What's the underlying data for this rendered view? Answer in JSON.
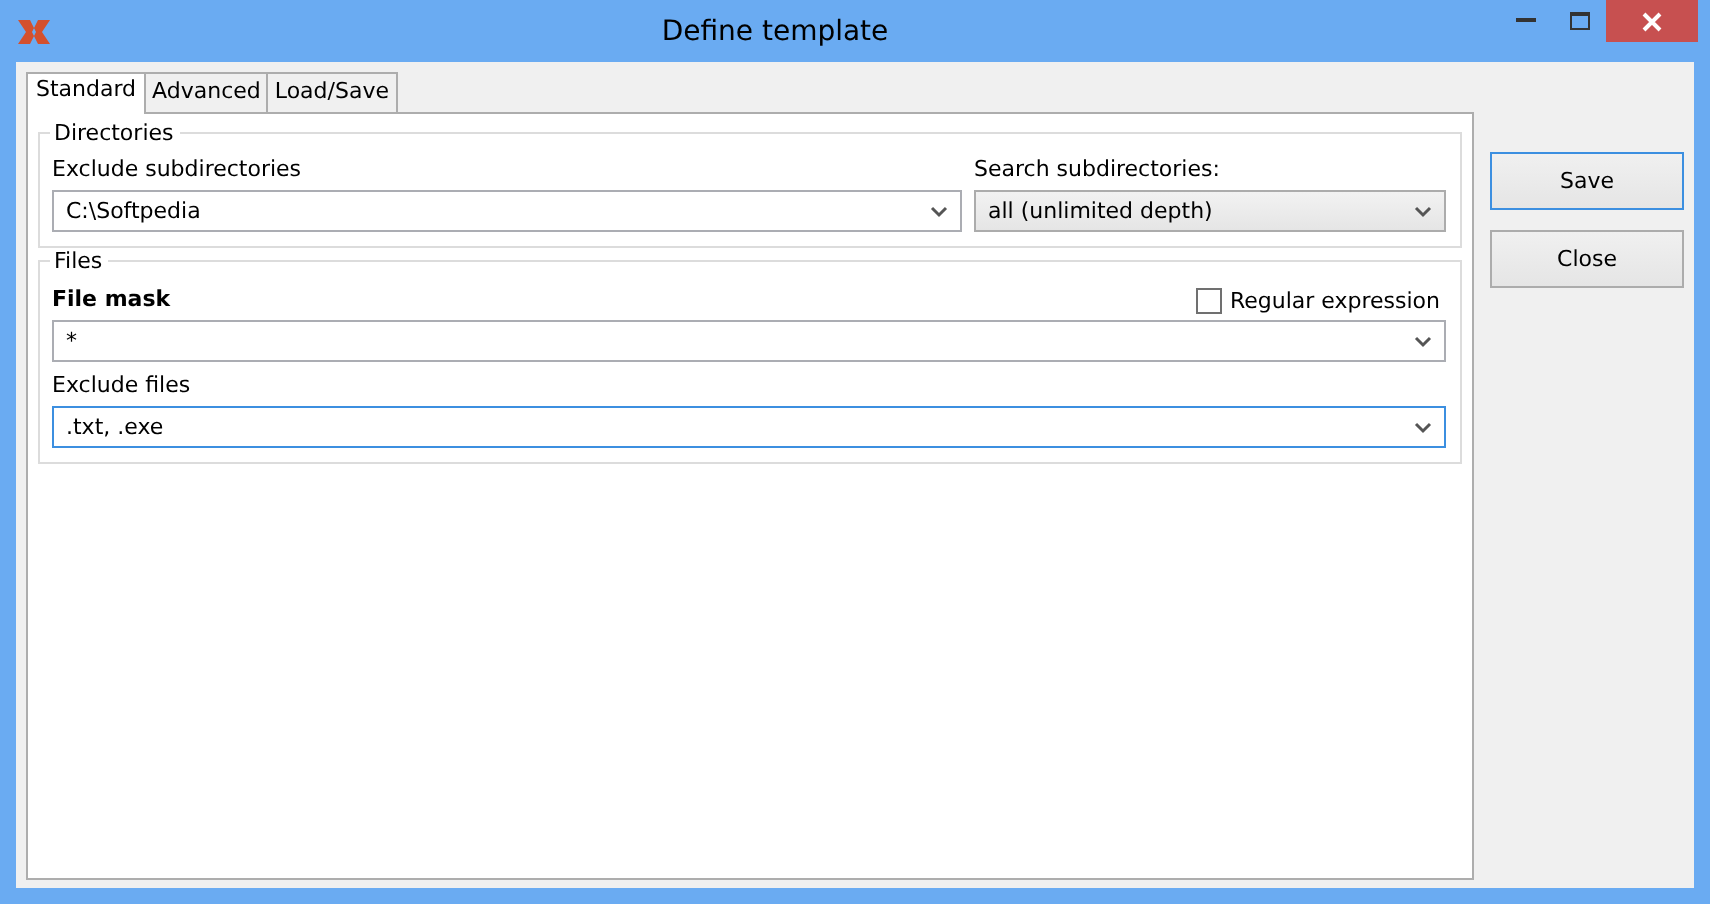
{
  "window": {
    "title": "Define template"
  },
  "tabs": [
    {
      "label": "Standard",
      "selected": true
    },
    {
      "label": "Advanced",
      "selected": false
    },
    {
      "label": "Load/Save",
      "selected": false
    }
  ],
  "directories": {
    "title": "Directories",
    "exclude_label": "Exclude subdirectories",
    "exclude_value": "C:\\Softpedia",
    "search_label": "Search subdirectories:",
    "search_value": "all (unlimited depth)"
  },
  "files": {
    "title": "Files",
    "mask_label": "File mask",
    "mask_value": "*",
    "regex_label": "Regular expression",
    "regex_checked": false,
    "exclude_label": "Exclude files",
    "exclude_value": ".txt, .exe"
  },
  "buttons": [
    {
      "label": "Save",
      "selected": true
    },
    {
      "label": "Close",
      "selected": false
    }
  ]
}
